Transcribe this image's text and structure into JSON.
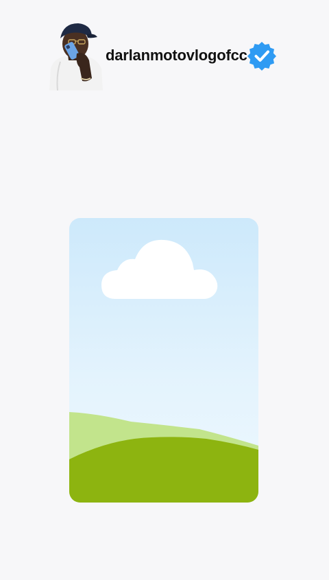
{
  "profile": {
    "username": "darlanmotovlogofcc",
    "verified": true,
    "avatar_icon": "person-on-phone-avatar",
    "verified_icon": "verified-badge-icon"
  },
  "media": {
    "icon": "image-placeholder-icon"
  },
  "colors": {
    "background": "#f7f7f9",
    "verified_badge": "#2f9bf3",
    "sky_top": "#cde9fb",
    "sky_bottom": "#ecf7fe",
    "hill_back": "#c2e48c",
    "hill_front": "#8db410"
  }
}
